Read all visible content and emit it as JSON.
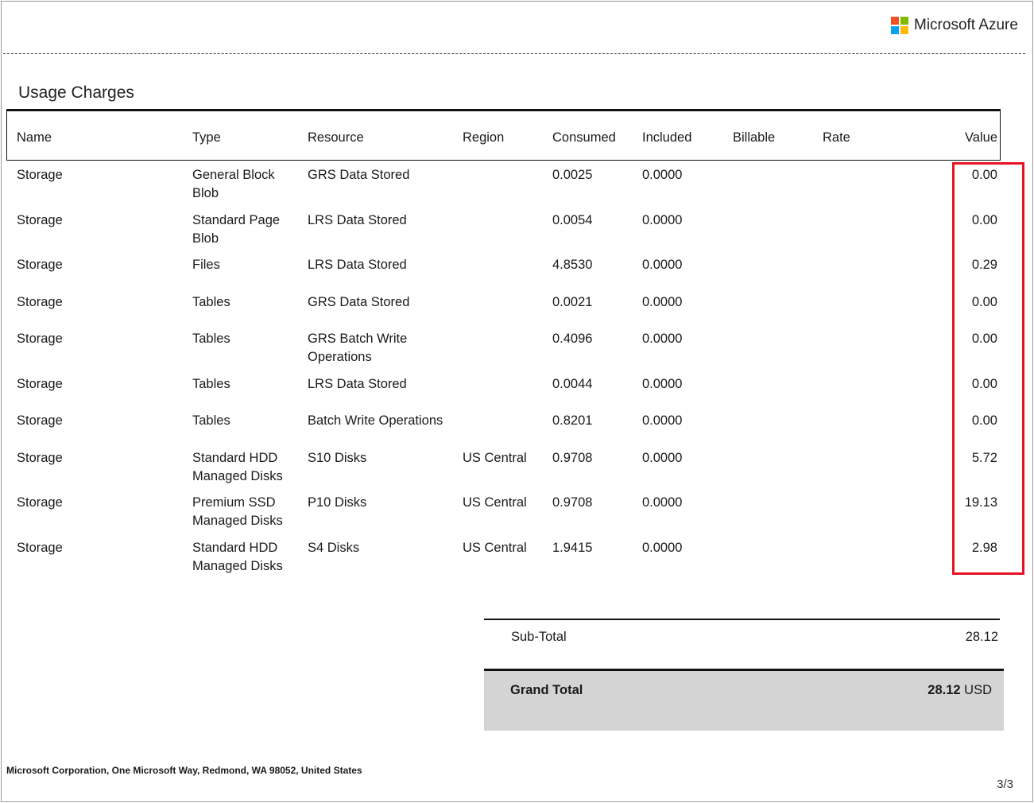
{
  "header": {
    "brand": "Microsoft Azure",
    "logo_colors": [
      "#f25022",
      "#7fba00",
      "#00a4ef",
      "#ffb900"
    ]
  },
  "section_title": "Usage Charges",
  "columns": [
    "Name",
    "Type",
    "Resource",
    "Region",
    "Consumed",
    "Included",
    "Billable",
    "Rate",
    "Value"
  ],
  "rows": [
    {
      "name": "Storage",
      "type": "General Block Blob",
      "resource": "GRS Data Stored",
      "region": "",
      "consumed": "0.0025",
      "included": "0.0000",
      "billable": "",
      "rate": "",
      "value": "0.00"
    },
    {
      "name": "Storage",
      "type": "Standard Page Blob",
      "resource": "LRS Data Stored",
      "region": "",
      "consumed": "0.0054",
      "included": "0.0000",
      "billable": "",
      "rate": "",
      "value": "0.00"
    },
    {
      "name": "Storage",
      "type": "Files",
      "resource": "LRS Data Stored",
      "region": "",
      "consumed": "4.8530",
      "included": "0.0000",
      "billable": "",
      "rate": "",
      "value": "0.29"
    },
    {
      "name": "Storage",
      "type": "Tables",
      "resource": "GRS Data Stored",
      "region": "",
      "consumed": "0.0021",
      "included": "0.0000",
      "billable": "",
      "rate": "",
      "value": "0.00"
    },
    {
      "name": "Storage",
      "type": "Tables",
      "resource": "GRS Batch Write Operations",
      "region": "",
      "consumed": "0.4096",
      "included": "0.0000",
      "billable": "",
      "rate": "",
      "value": "0.00"
    },
    {
      "name": "Storage",
      "type": "Tables",
      "resource": "LRS Data Stored",
      "region": "",
      "consumed": "0.0044",
      "included": "0.0000",
      "billable": "",
      "rate": "",
      "value": "0.00"
    },
    {
      "name": "Storage",
      "type": "Tables",
      "resource": "Batch Write Operations",
      "region": "",
      "consumed": "0.8201",
      "included": "0.0000",
      "billable": "",
      "rate": "",
      "value": "0.00"
    },
    {
      "name": "Storage",
      "type": "Standard HDD Managed Disks",
      "resource": "S10 Disks",
      "region": "US Central",
      "consumed": "0.9708",
      "included": "0.0000",
      "billable": "",
      "rate": "",
      "value": "5.72"
    },
    {
      "name": "Storage",
      "type": "Premium SSD Managed Disks",
      "resource": "P10 Disks",
      "region": "US Central",
      "consumed": "0.9708",
      "included": "0.0000",
      "billable": "",
      "rate": "",
      "value": "19.13"
    },
    {
      "name": "Storage",
      "type": "Standard HDD Managed Disks",
      "resource": "S4 Disks",
      "region": "US Central",
      "consumed": "1.9415",
      "included": "0.0000",
      "billable": "",
      "rate": "",
      "value": "2.98"
    }
  ],
  "highlight_color": "#e81123",
  "subtotal": {
    "label": "Sub-Total",
    "value": "28.12"
  },
  "grand_total": {
    "label": "Grand Total",
    "value": "28.12",
    "currency": "USD"
  },
  "footer": "Microsoft Corporation, One Microsoft Way, Redmond, WA 98052, United States",
  "page_number": "3/3"
}
